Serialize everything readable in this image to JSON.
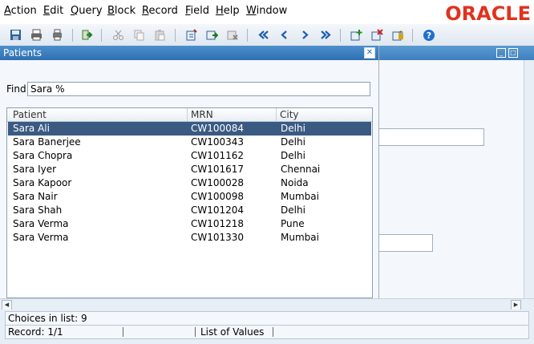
{
  "menu": [
    "Action",
    "Edit",
    "Query",
    "Block",
    "Record",
    "Field",
    "Help",
    "Window"
  ],
  "menu_accel": [
    "A",
    "E",
    "Q",
    "B",
    "R",
    "F",
    "H",
    "W"
  ],
  "menu_rest": [
    "ction",
    "dit",
    "uery",
    "lock",
    "ecord",
    "ield",
    "elp",
    "indow"
  ],
  "logo": "ORACLE",
  "dialog": {
    "title": "Patients",
    "find_label": "Find",
    "find_value": "Sara %"
  },
  "table": {
    "headers": [
      "Patient",
      "MRN",
      "City"
    ],
    "rows": [
      {
        "patient": "Sara Ali",
        "mrn": "CW100084",
        "city": "Delhi"
      },
      {
        "patient": "Sara Banerjee",
        "mrn": "CW100343",
        "city": "Delhi"
      },
      {
        "patient": "Sara Chopra",
        "mrn": "CW101162",
        "city": "Delhi"
      },
      {
        "patient": "Sara Iyer",
        "mrn": "CW101617",
        "city": "Chennai"
      },
      {
        "patient": "Sara Kapoor",
        "mrn": "CW100028",
        "city": "Noida"
      },
      {
        "patient": "Sara Nair",
        "mrn": "CW100098",
        "city": "Mumbai"
      },
      {
        "patient": "Sara Shah",
        "mrn": "CW101204",
        "city": "Delhi"
      },
      {
        "patient": "Sara Verma",
        "mrn": "CW101218",
        "city": "Pune"
      },
      {
        "patient": "Sara Verma",
        "mrn": "CW101330",
        "city": "Mumbai"
      }
    ],
    "selected_index": 0
  },
  "status": {
    "message": "Choices in list: 9",
    "record": "Record: 1/1",
    "mode": "List of Values"
  },
  "colors": {
    "oracle_red": "#e0321e",
    "title_blue": "#2f6fb0",
    "selection": "#3a5a82"
  }
}
